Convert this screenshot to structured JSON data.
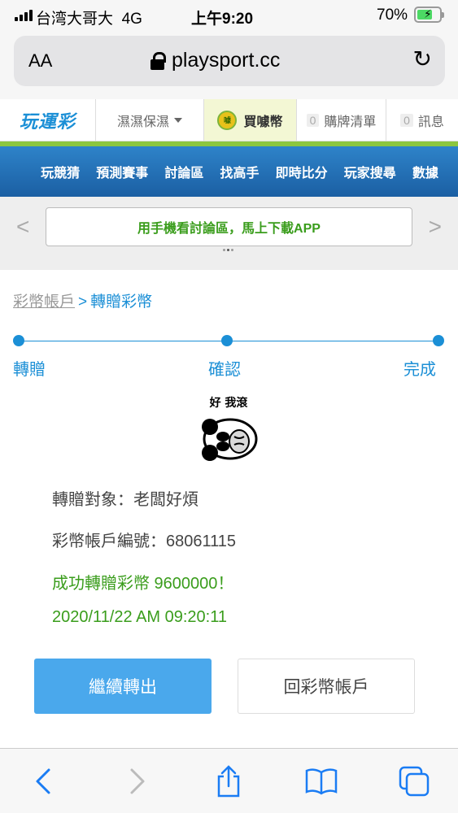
{
  "status_bar": {
    "carrier": "台湾大哥大",
    "network": "4G",
    "time": "上午9:20",
    "battery": "70%",
    "battery_level": 0.7
  },
  "browser": {
    "aa_label": "AA",
    "url": "playsport.cc",
    "icons": [
      "lock-icon",
      "reload-icon",
      "back-icon",
      "forward-icon",
      "share-icon",
      "bookmarks-icon",
      "tabs-icon"
    ]
  },
  "site_header": {
    "logo": "玩運彩",
    "user": "濕濕保濕",
    "buy": "買噱幣",
    "cart_count": "0",
    "cart": "購牌清單",
    "msg_count": "0",
    "msg": "訊息"
  },
  "nav": [
    "玩競猜",
    "預測賽事",
    "討論區",
    "找高手",
    "即時比分",
    "玩家搜尋",
    "數據"
  ],
  "banner": "用手機看討論區，馬上下載APP",
  "breadcrumb": {
    "parent": "彩幣帳戶",
    "sep": ">",
    "current": "轉贈彩幣"
  },
  "steps": [
    "轉贈",
    "確認",
    "完成"
  ],
  "sticker_text": "好 我滾",
  "result": {
    "recipient": "轉贈對象：老闆好煩",
    "account": "彩幣帳戶編號：68061115",
    "success": "成功轉贈彩幣 9600000！",
    "timestamp": "2020/11/22 AM 09:20:11"
  },
  "buttons": {
    "continue": "繼續轉出",
    "back": "回彩幣帳戶"
  },
  "colors": {
    "accent": "#1b8fd6",
    "success": "#3a9d1c",
    "primary_button": "#4aa8ec",
    "nav": "#1b5fa3"
  }
}
